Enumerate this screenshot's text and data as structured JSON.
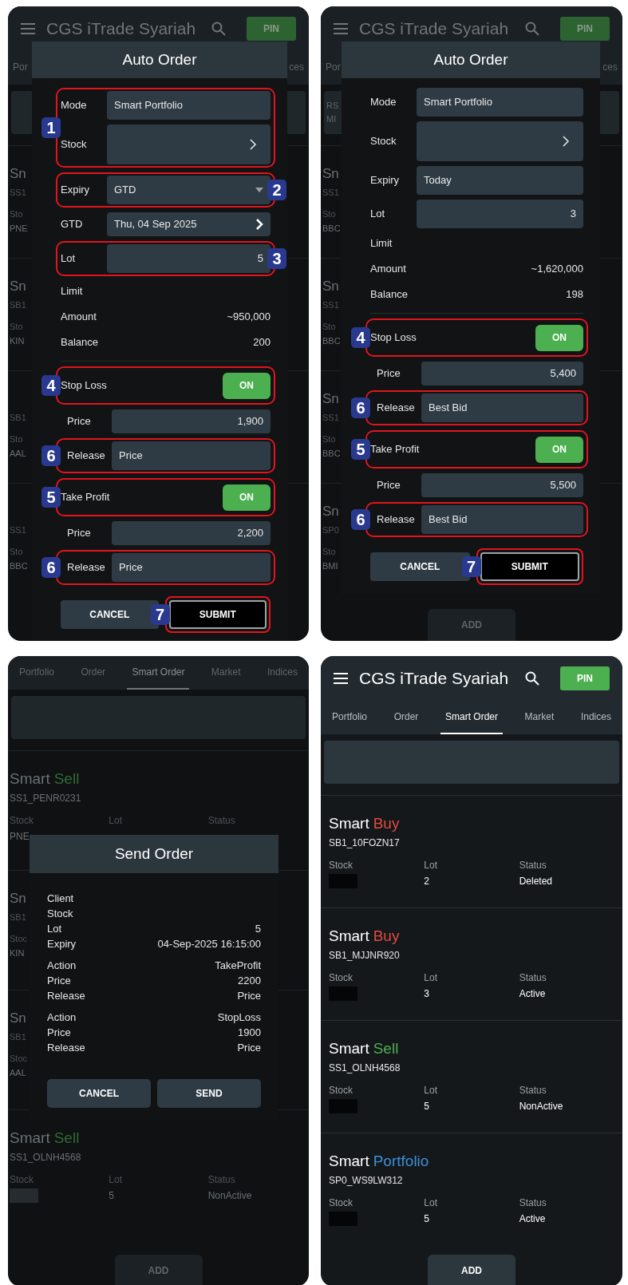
{
  "panels": [
    {
      "kind": "auto_order",
      "background": {
        "header": {
          "title": "CGS iTrade Syariah",
          "pin": "PIN"
        },
        "tabs": [
          {
            "label": "Por",
            "selected": false
          },
          {
            "label": "ces",
            "selected": false
          }
        ],
        "items": [
          {
            "kind": "fragment",
            "title": "Sn",
            "code": "SS1",
            "label": "Sto",
            "value": "PNE"
          },
          {
            "kind": "fragment",
            "title": "Sn",
            "code": "SB1",
            "label": "Sto",
            "value": "KIN"
          },
          {
            "kind": "fragment",
            "code": "SB1",
            "label": "Sto",
            "value": "AAL"
          },
          {
            "kind": "fragment",
            "code": "SS1",
            "label": "Sto",
            "value": "BBC"
          }
        ]
      },
      "dialog": {
        "title": "Auto Order",
        "groups": [
          {
            "callout": "1",
            "rows": [
              {
                "kind": "field",
                "label": "Mode",
                "value": "Smart Portfolio"
              },
              {
                "kind": "picker",
                "label": "Stock"
              }
            ]
          },
          {
            "callout": "2",
            "rows": [
              {
                "kind": "dropdown",
                "label": "Expiry",
                "value": "GTD"
              }
            ]
          },
          {
            "rows": [
              {
                "kind": "date",
                "label": "GTD",
                "value": "Thu, 04 Sep 2025"
              }
            ]
          },
          {
            "callout": "3",
            "rows": [
              {
                "kind": "number",
                "label": "Lot",
                "value": "5"
              }
            ]
          },
          {
            "rows": [
              {
                "kind": "info",
                "label": "Limit"
              },
              {
                "kind": "info",
                "label": "Amount",
                "value": "~950,000"
              },
              {
                "kind": "info",
                "label": "Balance",
                "value": "200"
              },
              {
                "kind": "divider"
              }
            ]
          },
          {
            "callout": "4",
            "rows": [
              {
                "kind": "toggle",
                "label": "Stop Loss",
                "on": true,
                "state_label": "ON"
              }
            ]
          },
          {
            "rows": [
              {
                "kind": "subnumber",
                "label": "Price",
                "value": "1,900"
              }
            ]
          },
          {
            "callout": "6",
            "rows": [
              {
                "kind": "subfield",
                "label": "Release",
                "value": "Price"
              }
            ]
          },
          {
            "callout": "5",
            "rows": [
              {
                "kind": "toggle",
                "label": "Take Profit",
                "on": true,
                "state_label": "ON"
              }
            ]
          },
          {
            "rows": [
              {
                "kind": "subnumber",
                "label": "Price",
                "value": "2,200"
              }
            ]
          },
          {
            "callout": "6",
            "rows": [
              {
                "kind": "subfield",
                "label": "Release",
                "value": "Price"
              }
            ]
          }
        ],
        "buttons": [
          {
            "kind": "filled",
            "label": "CANCEL"
          },
          {
            "kind": "outlined",
            "label": "SUBMIT",
            "callout": "7"
          }
        ]
      }
    },
    {
      "kind": "auto_order",
      "background": {
        "header": {
          "title": "CGS iTrade Syariah",
          "pin": "PIN"
        },
        "tabs": [
          {
            "label": "Por",
            "selected": false
          },
          {
            "label": "ces",
            "selected": false
          }
        ],
        "card_lines": [
          "RS",
          "MI"
        ],
        "items": [
          {
            "kind": "fragment",
            "title": "Sn",
            "code": "SS1",
            "label": "Sto",
            "value": "BBC"
          },
          {
            "kind": "fragment",
            "title": "Sn",
            "code": "SS1",
            "label": "Sto",
            "value": "BBC"
          },
          {
            "kind": "fragment",
            "title": "Sn",
            "code": "SS1",
            "label": "Sto",
            "value": "BBC"
          },
          {
            "kind": "fragment",
            "title": "Sn",
            "code": "SP0",
            "label": "Sto",
            "value": "BMI"
          }
        ],
        "add_button": "ADD"
      },
      "dialog": {
        "title": "Auto Order",
        "groups": [
          {
            "rows": [
              {
                "kind": "field",
                "label": "Mode",
                "value": "Smart Portfolio"
              },
              {
                "kind": "picker",
                "label": "Stock"
              },
              {
                "kind": "field",
                "label": "Expiry",
                "value": "Today"
              },
              {
                "kind": "number",
                "label": "Lot",
                "value": "3"
              },
              {
                "kind": "info",
                "label": "Limit"
              },
              {
                "kind": "info",
                "label": "Amount",
                "value": "~1,620,000"
              },
              {
                "kind": "info",
                "label": "Balance",
                "value": "198"
              },
              {
                "kind": "divider"
              }
            ]
          },
          {
            "callout": "4",
            "rows": [
              {
                "kind": "toggle",
                "label": "Stop Loss",
                "on": true,
                "state_label": "ON"
              }
            ]
          },
          {
            "rows": [
              {
                "kind": "subnumber",
                "label": "Price",
                "value": "5,400"
              }
            ]
          },
          {
            "callout": "6",
            "rows": [
              {
                "kind": "subfield",
                "label": "Release",
                "value": "Best Bid"
              }
            ]
          },
          {
            "callout": "5",
            "rows": [
              {
                "kind": "toggle",
                "label": "Take Profit",
                "on": true,
                "state_label": "ON"
              }
            ]
          },
          {
            "rows": [
              {
                "kind": "subnumber",
                "label": "Price",
                "value": "5,500"
              }
            ]
          },
          {
            "callout": "6",
            "rows": [
              {
                "kind": "subfield",
                "label": "Release",
                "value": "Best Bid"
              }
            ]
          }
        ],
        "buttons": [
          {
            "kind": "filled",
            "label": "CANCEL"
          },
          {
            "kind": "outlined",
            "label": "SUBMIT",
            "callout": "7"
          }
        ]
      }
    },
    {
      "kind": "send_order",
      "background": {
        "tabs": [
          {
            "label": "Portfolio",
            "selected": false
          },
          {
            "label": "Order",
            "selected": false
          },
          {
            "label": "Smart Order",
            "selected": true
          },
          {
            "label": "Market",
            "selected": false
          },
          {
            "label": "Indices",
            "selected": false
          }
        ],
        "items": [
          {
            "kind": "full",
            "prefix": "Smart",
            "type": "Sell",
            "color": "#2f6b34",
            "code": "SS1_PENR0231",
            "columns": [
              {
                "label": "Stock",
                "value": "PNE"
              },
              {
                "label": "Lot"
              },
              {
                "label": "Status"
              }
            ]
          },
          {
            "kind": "fragment",
            "title": "Sn",
            "code": "SB1",
            "label": "Stoc",
            "value": "KIN"
          },
          {
            "kind": "fragment",
            "title": "Sn",
            "code": "SB1",
            "label": "Stoc",
            "value": "AAL"
          },
          {
            "kind": "full",
            "prefix": "Smart",
            "type": "Sell",
            "color": "#2f6b34",
            "code": "SS1_OLNH4568",
            "columns": [
              {
                "label": "Stock",
                "redacted": true
              },
              {
                "label": "Lot",
                "value": "5"
              },
              {
                "label": "Status",
                "value": "NonActive"
              }
            ]
          }
        ],
        "add_button": "ADD"
      },
      "dialog": {
        "title": "Send Order",
        "sections": [
          {
            "rows": [
              {
                "label": "Client"
              },
              {
                "label": "Stock"
              },
              {
                "label": "Lot",
                "value": "5"
              },
              {
                "label": "Expiry",
                "value": "04-Sep-2025 16:15:00"
              }
            ]
          },
          {
            "rows": [
              {
                "label": "Action",
                "value": "TakeProfit"
              },
              {
                "label": "Price",
                "value": "2200"
              },
              {
                "label": "Release",
                "value": "Price"
              }
            ]
          },
          {
            "rows": [
              {
                "label": "Action",
                "value": "StopLoss"
              },
              {
                "label": "Price",
                "value": "1900"
              },
              {
                "label": "Release",
                "value": "Price"
              }
            ]
          }
        ],
        "buttons": [
          {
            "kind": "filled",
            "label": "CANCEL"
          },
          {
            "kind": "filled",
            "label": "SEND"
          }
        ]
      }
    },
    {
      "kind": "list",
      "background": {
        "header": {
          "title": "CGS iTrade Syariah",
          "pin": "PIN"
        },
        "tabs": [
          {
            "label": "Portfolio",
            "selected": false
          },
          {
            "label": "Order",
            "selected": false
          },
          {
            "label": "Smart Order",
            "selected": true
          },
          {
            "label": "Market",
            "selected": false
          },
          {
            "label": "Indices",
            "selected": false
          }
        ],
        "items": [
          {
            "kind": "full",
            "prefix": "Smart",
            "type": "Buy",
            "color": "#e04a3f",
            "code": "SB1_10FOZN17",
            "columns": [
              {
                "label": "Stock",
                "redacted": true
              },
              {
                "label": "Lot",
                "value": "2"
              },
              {
                "label": "Status",
                "value": "Deleted"
              }
            ]
          },
          {
            "kind": "full",
            "prefix": "Smart",
            "type": "Buy",
            "color": "#e04a3f",
            "code": "SB1_MJJNR920",
            "columns": [
              {
                "label": "Stock",
                "redacted": true
              },
              {
                "label": "Lot",
                "value": "3"
              },
              {
                "label": "Status",
                "value": "Active"
              }
            ]
          },
          {
            "kind": "full",
            "prefix": "Smart",
            "type": "Sell",
            "color": "#4caf50",
            "code": "SS1_OLNH4568",
            "columns": [
              {
                "label": "Stock",
                "redacted": true
              },
              {
                "label": "Lot",
                "value": "5"
              },
              {
                "label": "Status",
                "value": "NonActive"
              }
            ]
          },
          {
            "kind": "full",
            "prefix": "Smart",
            "type": "Portfolio",
            "color": "#3b8fd9",
            "code": "SP0_WS9LW312",
            "columns": [
              {
                "label": "Stock",
                "redacted": true
              },
              {
                "label": "Lot",
                "value": "5"
              },
              {
                "label": "Status",
                "value": "Active"
              }
            ]
          }
        ],
        "add_button": "ADD"
      }
    }
  ]
}
